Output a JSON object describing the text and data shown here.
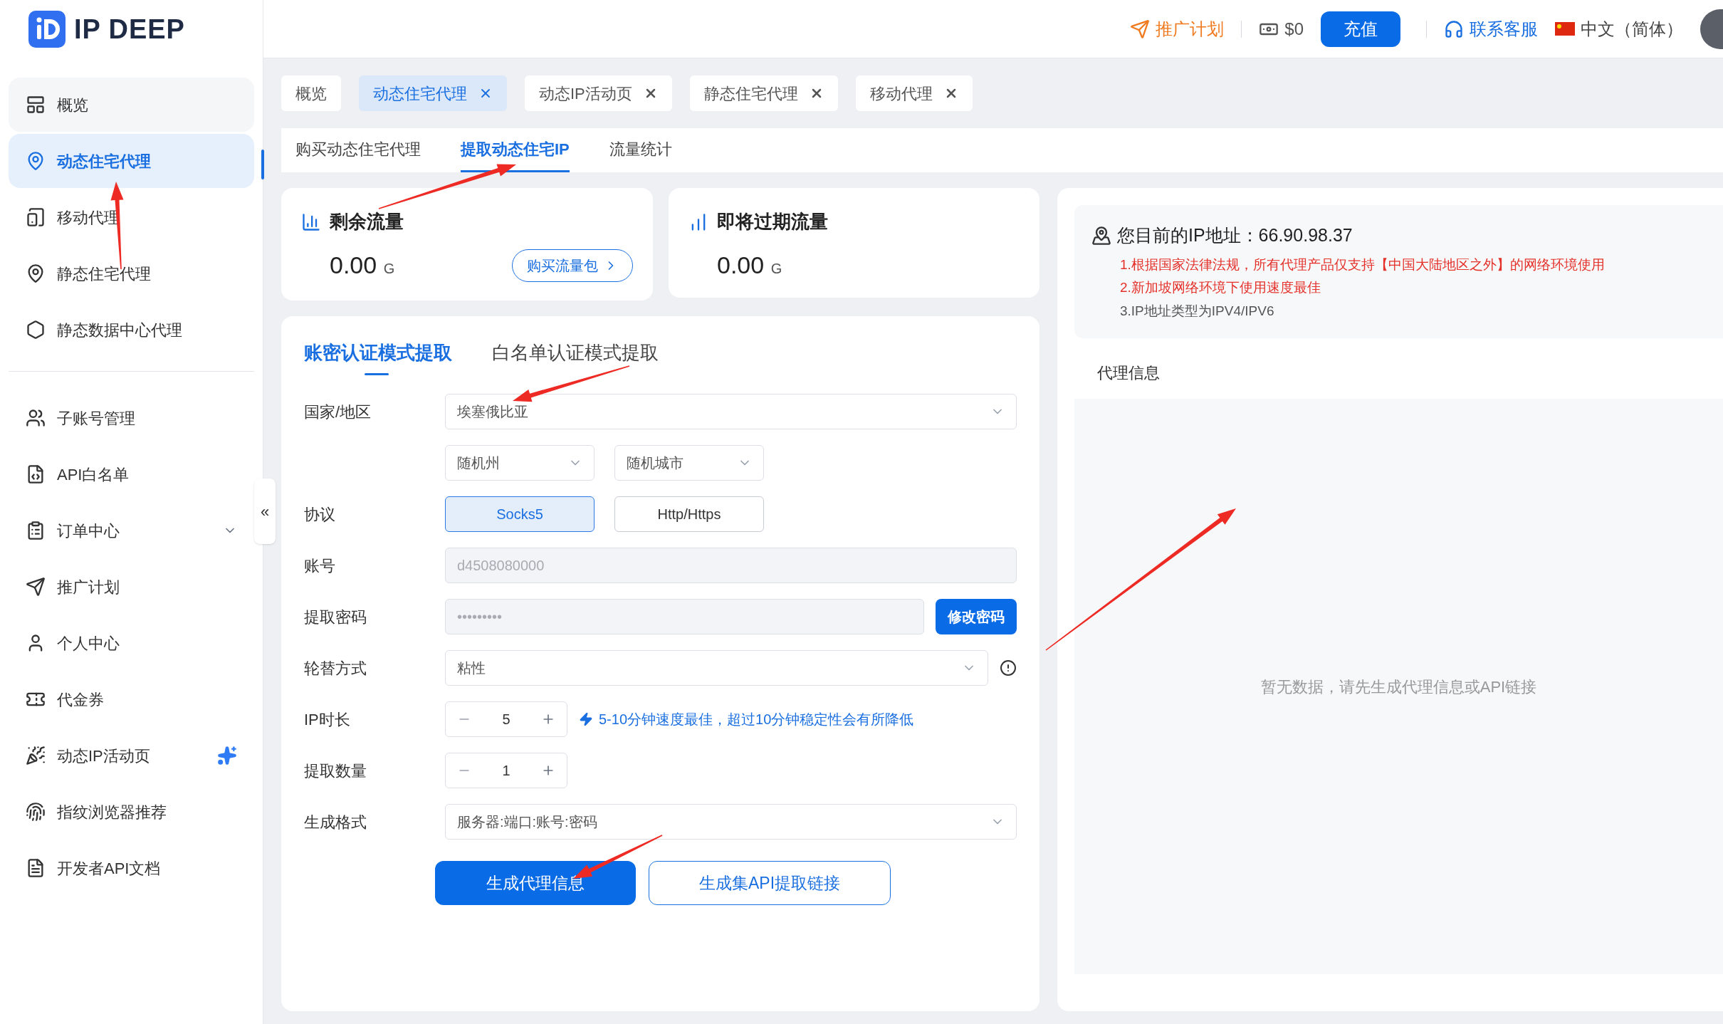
{
  "header": {
    "logo": "IP DEEP",
    "promo": "推广计划",
    "balance": "$0",
    "recharge": "充值",
    "support": "联系客服",
    "language": "中文（简体）"
  },
  "sidebar": {
    "groups": [
      [
        {
          "label": "概览",
          "kind": "link",
          "selected": false
        },
        {
          "label": "动态住宅代理",
          "kind": "link",
          "selected": true
        },
        {
          "label": "移动代理",
          "kind": "link",
          "selected": false
        },
        {
          "label": "静态住宅代理",
          "kind": "link",
          "selected": false
        },
        {
          "label": "静态数据中心代理",
          "kind": "link",
          "selected": false
        }
      ],
      [
        {
          "label": "子账号管理",
          "kind": "link",
          "selected": false
        },
        {
          "label": "API白名单",
          "kind": "link",
          "selected": false
        },
        {
          "label": "订单中心",
          "kind": "submenu",
          "selected": false,
          "expanded": false
        },
        {
          "label": "推广计划",
          "kind": "link",
          "selected": false
        },
        {
          "label": "个人中心",
          "kind": "link",
          "selected": false
        },
        {
          "label": "代金券",
          "kind": "link",
          "selected": false
        },
        {
          "label": "动态IP活动页",
          "kind": "featured",
          "selected": false
        },
        {
          "label": "指纹浏览器推荐",
          "kind": "link",
          "selected": false
        },
        {
          "label": "开发者API文档",
          "kind": "link",
          "selected": false
        }
      ]
    ],
    "collapse_toggle": "«"
  },
  "tabs": [
    {
      "label": "概览",
      "selected": false,
      "closable": false
    },
    {
      "label": "动态住宅代理",
      "selected": true,
      "closable": true
    },
    {
      "label": "动态IP活动页",
      "selected": false,
      "closable": true
    },
    {
      "label": "静态住宅代理",
      "selected": false,
      "closable": true
    },
    {
      "label": "移动代理",
      "selected": false,
      "closable": true
    }
  ],
  "subtabs": [
    {
      "label": "购买动态住宅代理",
      "selected": false
    },
    {
      "label": "提取动态住宅IP",
      "selected": true
    },
    {
      "label": "流量统计",
      "selected": false
    }
  ],
  "cards": [
    {
      "title": "剩余流量",
      "value": "0.00",
      "unit": "G",
      "button": "购买流量包"
    },
    {
      "title": "即将过期流量",
      "value": "0.00",
      "unit": "G"
    }
  ],
  "form": {
    "mode_tabs": [
      {
        "label": "账密认证模式提取",
        "selected": true
      },
      {
        "label": "白名单认证模式提取",
        "selected": false
      }
    ],
    "country": {
      "label": "国家/地区",
      "value": "埃塞俄比亚"
    },
    "region": {
      "state": "随机州",
      "city": "随机城市"
    },
    "protocol": {
      "label": "协议",
      "options": [
        {
          "label": "Socks5",
          "selected": true
        },
        {
          "label": "Http/Https",
          "selected": false
        }
      ]
    },
    "account": {
      "label": "账号",
      "value": "d4508080000",
      "disabled": true
    },
    "password": {
      "label": "提取密码",
      "value": "•••••••••",
      "disabled": true,
      "button": "修改密码"
    },
    "rotation": {
      "label": "轮替方式",
      "value": "粘性"
    },
    "duration": {
      "label": "IP时长",
      "value": "5",
      "hint": "5-10分钟速度最佳，超过10分钟稳定性会有所降低"
    },
    "quantity": {
      "label": "提取数量",
      "value": "1"
    },
    "format": {
      "label": "生成格式",
      "value": "服务器:端口:账号:密码"
    },
    "buttons": [
      {
        "label": "生成代理信息",
        "kind": "primary"
      },
      {
        "label": "生成集API提取链接",
        "kind": "outline"
      }
    ]
  },
  "ip_panel": {
    "title": "您目前的IP地址：66.90.98.37",
    "notes": [
      {
        "text": "1.根据国家法律法规，所有代理产品仅支持【中国大陆地区之外】的网络环境使用",
        "kind": "warning"
      },
      {
        "text": "2.新加坡网络环境下使用速度最佳",
        "kind": "warning"
      },
      {
        "text": "3.IP地址类型为IPV4/IPV6",
        "kind": "info"
      }
    ],
    "section_title": "代理信息",
    "empty_text": "暂无数据，请先生成代理信息或API链接"
  }
}
